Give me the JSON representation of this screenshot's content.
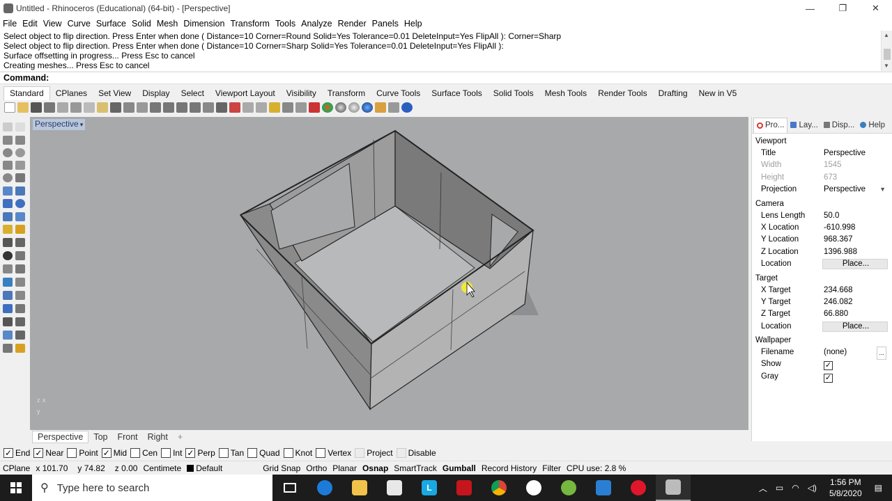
{
  "window": {
    "title": "Untitled - Rhinoceros (Educational) (64-bit) - [Perspective]",
    "controls": {
      "minimize": "—",
      "restore": "❐",
      "close": "✕"
    }
  },
  "menu": [
    "File",
    "Edit",
    "View",
    "Curve",
    "Surface",
    "Solid",
    "Mesh",
    "Dimension",
    "Transform",
    "Tools",
    "Analyze",
    "Render",
    "Panels",
    "Help"
  ],
  "history": [
    "Select object to flip direction. Press Enter when done ( Distance=10  Corner=Round  Solid=Yes  Tolerance=0.01  DeleteInput=Yes  FlipAll ): Corner=Sharp",
    "Select object to flip direction. Press Enter when done ( Distance=10  Corner=Sharp  Solid=Yes  Tolerance=0.01  DeleteInput=Yes  FlipAll ):",
    "Surface offsetting in progress... Press Esc to cancel",
    "Creating meshes... Press Esc to cancel"
  ],
  "command_prompt": "Command:",
  "toolbar_tabs": [
    "Standard",
    "CPlanes",
    "Set View",
    "Display",
    "Select",
    "Viewport Layout",
    "Visibility",
    "Transform",
    "Curve Tools",
    "Surface Tools",
    "Solid Tools",
    "Mesh Tools",
    "Render Tools",
    "Drafting",
    "New in V5"
  ],
  "viewport": {
    "label": "Perspective",
    "axis_label_x": "x",
    "axis_label_y": "y",
    "axis_label_z": "z",
    "background": "#a8a9ab"
  },
  "view_tabs": [
    "Perspective",
    "Top",
    "Front",
    "Right"
  ],
  "view_tab_add": "+",
  "panel": {
    "tabs": [
      "Pro...",
      "Lay...",
      "Disp...",
      "Help"
    ],
    "viewport_group": "Viewport",
    "title_label": "Title",
    "title_value": "Perspective",
    "width_label": "Width",
    "width_value": "1545",
    "height_label": "Height",
    "height_value": "673",
    "projection_label": "Projection",
    "projection_value": "Perspective",
    "camera_group": "Camera",
    "lens_label": "Lens Length",
    "lens_value": "50.0",
    "xloc_label": "X Location",
    "xloc_value": "-610.998",
    "yloc_label": "Y Location",
    "yloc_value": "968.367",
    "zloc_label": "Z Location",
    "zloc_value": "1396.988",
    "location_label": "Location",
    "place_label": "Place...",
    "target_group": "Target",
    "xt_label": "X Target",
    "xt_value": "234.668",
    "yt_label": "Y Target",
    "yt_value": "246.082",
    "zt_label": "Z Target",
    "zt_value": "66.880",
    "wallpaper_group": "Wallpaper",
    "filename_label": "Filename",
    "filename_value": "(none)",
    "browse_label": "...",
    "show_label": "Show",
    "gray_label": "Gray"
  },
  "osnaps": [
    {
      "label": "End",
      "checked": true
    },
    {
      "label": "Near",
      "checked": true
    },
    {
      "label": "Point",
      "checked": false
    },
    {
      "label": "Mid",
      "checked": true
    },
    {
      "label": "Cen",
      "checked": false
    },
    {
      "label": "Int",
      "checked": false
    },
    {
      "label": "Perp",
      "checked": true
    },
    {
      "label": "Tan",
      "checked": false
    },
    {
      "label": "Quad",
      "checked": false
    },
    {
      "label": "Knot",
      "checked": false
    },
    {
      "label": "Vertex",
      "checked": false
    },
    {
      "label": "Project",
      "checked": false,
      "disabled": true
    },
    {
      "label": "Disable",
      "checked": false,
      "disabled": true
    }
  ],
  "status": {
    "cplane": "CPlane",
    "x": "x 101.70",
    "y": "y 74.82",
    "z": "z 0.00",
    "units": "Centimete",
    "layer": "Default",
    "grid_snap": "Grid Snap",
    "ortho": "Ortho",
    "planar": "Planar",
    "osnap": "Osnap",
    "smarttrack": "SmartTrack",
    "gumball": "Gumball",
    "record_history": "Record History",
    "filter": "Filter",
    "cpu": "CPU use: 2.8 %"
  },
  "taskbar": {
    "search_placeholder": "Type here to search",
    "time": "1:56 PM",
    "date": "5/8/2020"
  }
}
